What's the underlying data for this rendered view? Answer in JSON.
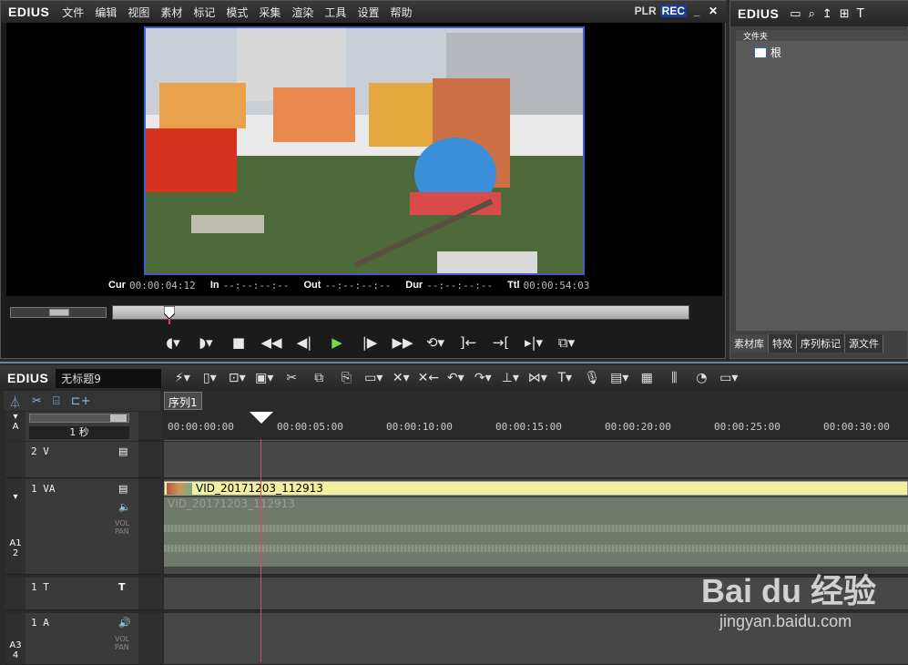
{
  "player": {
    "logo": "EDIUS",
    "menu": [
      "文件",
      "编辑",
      "视图",
      "素材",
      "标记",
      "模式",
      "采集",
      "渲染",
      "工具",
      "设置",
      "帮助"
    ],
    "mode_plr": "PLR",
    "mode_rec": "REC",
    "timecodes": [
      {
        "label": "Cur",
        "value": "00:00:04:12"
      },
      {
        "label": "In",
        "value": "--:--:--:--"
      },
      {
        "label": "Out",
        "value": "--:--:--:--"
      },
      {
        "label": "Dur",
        "value": "--:--:--:--"
      },
      {
        "label": "Ttl",
        "value": "00:00:54:03"
      }
    ],
    "scrub_position": 0.09
  },
  "bin": {
    "logo": "EDIUS",
    "folder_header": "文件夹",
    "root_label": "根",
    "tabs": [
      "素材库",
      "特效",
      "序列标记",
      "源文件"
    ]
  },
  "timeline": {
    "logo": "EDIUS",
    "project_title": "无标题9",
    "sequence_tab": "序列1",
    "scale_label": "1 秒",
    "ruler_ticks": [
      "00:00:00:00",
      "00:00:05:00",
      "00:00:10:00",
      "00:00:15:00",
      "00:00:20:00",
      "00:00:25:00",
      "00:00:30:00"
    ],
    "tracks": [
      {
        "name": "2 V",
        "type": "video"
      },
      {
        "name": "1 VA",
        "type": "videoaudio",
        "clip_name": "VID_20171203_112913",
        "audio_clip_name": "VID_20171203_112913",
        "side_label": "A1 2"
      },
      {
        "name": "1 T",
        "type": "title"
      },
      {
        "name": "1 A",
        "type": "audio",
        "side_label": "A3 4"
      }
    ],
    "vol_pan_label": "VOL PAN"
  },
  "watermark": {
    "brand": "Bai du 经验",
    "url": "jingyan.baidu.com"
  },
  "colors": {
    "accent_blue": "#3a62c8",
    "play_green": "#7ad64b",
    "clip_yellow": "#f2ef9e",
    "playhead": "#d46"
  }
}
